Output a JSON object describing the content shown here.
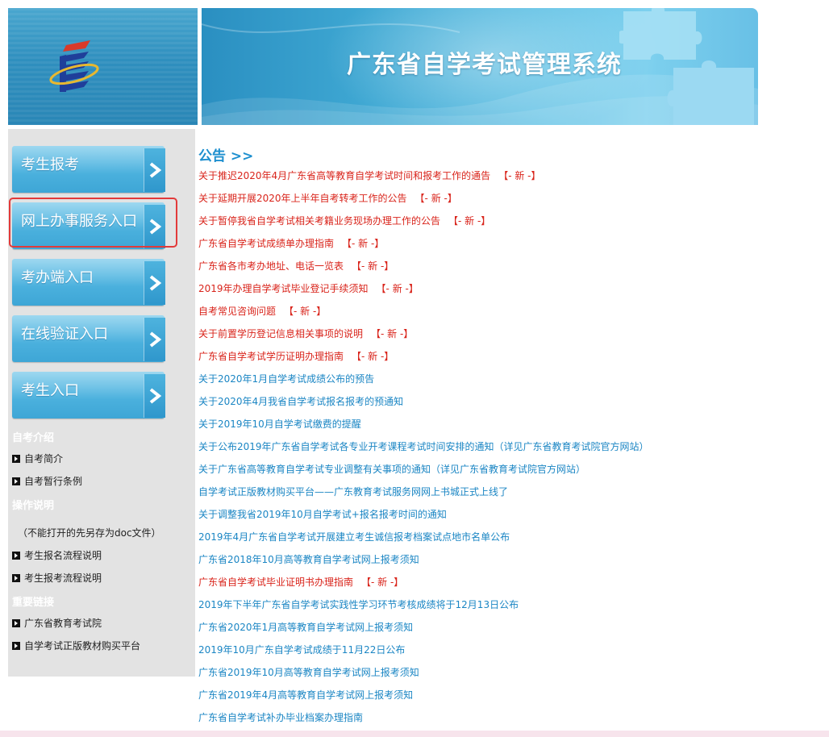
{
  "header": {
    "title": "广东省自学考试管理系统"
  },
  "sidebar": {
    "nav": [
      {
        "label": "考生报考"
      },
      {
        "label": "网上办事服务入口"
      },
      {
        "label": "考办端入口"
      },
      {
        "label": "在线验证入口"
      },
      {
        "label": "考生入口"
      }
    ],
    "sections": {
      "intro_title": "自考介绍",
      "intro_links": [
        "自考简介",
        "自考暂行条例"
      ],
      "ops_title": "操作说明",
      "ops_note": "（不能打开的先另存为doc文件）",
      "ops_links": [
        "考生报名流程说明",
        "考生报考流程说明"
      ],
      "links_title": "重要链接",
      "important_links": [
        "广东省教育考试院",
        "自学考试正版教材购买平台"
      ]
    }
  },
  "notices": {
    "heading": "公告 >>",
    "new_label": "【- 新 -】",
    "items": [
      {
        "text": "关于推迟2020年4月广东省高等教育自学考试时间和报考工作的通告",
        "is_new": true
      },
      {
        "text": "关于延期开展2020年上半年自考转考工作的公告",
        "is_new": true
      },
      {
        "text": "关于暂停我省自学考试相关考籍业务现场办理工作的公告",
        "is_new": true
      },
      {
        "text": "广东省自学考试成绩单办理指南",
        "is_new": true
      },
      {
        "text": "广东省各市考办地址、电话一览表",
        "is_new": true
      },
      {
        "text": "2019年办理自学考试毕业登记手续须知",
        "is_new": true
      },
      {
        "text": "自考常见咨询问题",
        "is_new": true
      },
      {
        "text": "关于前置学历登记信息相关事项的说明",
        "is_new": true
      },
      {
        "text": "广东省自学考试学历证明办理指南",
        "is_new": true
      },
      {
        "text": "关于2020年1月自学考试成绩公布的预告",
        "is_new": false
      },
      {
        "text": "关于2020年4月我省自学考试报名报考的预通知",
        "is_new": false
      },
      {
        "text": "关于2019年10月自学考试缴费的提醒",
        "is_new": false
      },
      {
        "text": "关于公布2019年广东省自学考试各专业开考课程考试时间安排的通知（详见广东省教育考试院官方网站）",
        "is_new": false
      },
      {
        "text": "关于广东省高等教育自学考试专业调整有关事项的通知（详见广东省教育考试院官方网站）",
        "is_new": false
      },
      {
        "text": "自学考试正版教材购买平台——广东教育考试服务网网上书城正式上线了",
        "is_new": false
      },
      {
        "text": "关于调整我省2019年10月自学考试+报名报考时间的通知",
        "is_new": false
      },
      {
        "text": "2019年4月广东省自学考试开展建立考生诚信报考档案试点地市名单公布",
        "is_new": false
      },
      {
        "text": "广东省2018年10月高等教育自学考试网上报考须知",
        "is_new": false
      },
      {
        "text": "广东省自学考试毕业证明书办理指南",
        "is_new": true
      },
      {
        "text": "2019年下半年广东省自学考试实践性学习环节考核成绩将于12月13日公布",
        "is_new": false
      },
      {
        "text": "广东省2020年1月高等教育自学考试网上报考须知",
        "is_new": false
      },
      {
        "text": "2019年10月广东自学考试成绩于11月22日公布",
        "is_new": false
      },
      {
        "text": "广东省2019年10月高等教育自学考试网上报考须知",
        "is_new": false
      },
      {
        "text": "广东省2019年4月高等教育自学考试网上报考须知",
        "is_new": false
      },
      {
        "text": "广东省自学考试补办毕业档案办理指南",
        "is_new": false
      }
    ]
  },
  "colors": {
    "link_red": "#d9241b",
    "link_blue": "#1b86c4",
    "heading_blue": "#1d8fcf",
    "highlight_border": "#e23a3a",
    "sidebar_bg": "#e3e3e3"
  },
  "icons": {
    "logo": "exam-authority-logo-icon",
    "nav_arrow": "chevron-right-icon",
    "bullet": "bullet-arrow-icon",
    "decoration": "puzzle-piece-icon"
  }
}
